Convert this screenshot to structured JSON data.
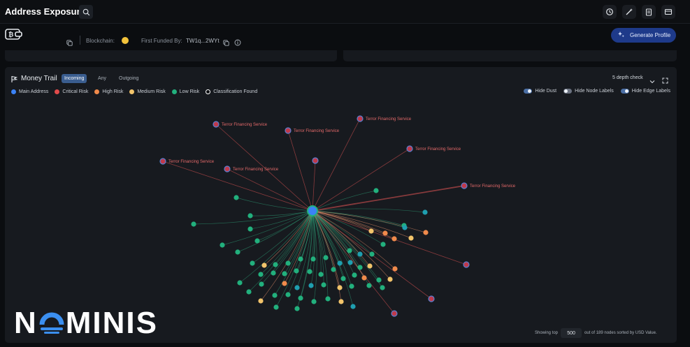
{
  "header": {
    "title": "Address Exposure",
    "icons": [
      "search-icon",
      "history-icon",
      "magic-wand-icon",
      "clipboard-icon",
      "card-icon"
    ]
  },
  "subheader": {
    "blockchain_label": "Blockchain:",
    "first_funded_label": "First Funded By:",
    "first_funded_value": "TW1q...2WYt",
    "generate_profile": "Generate Profile"
  },
  "money_trail": {
    "title": "Money Trail",
    "tabs": [
      {
        "label": "Incoming",
        "active": true
      },
      {
        "label": "Any",
        "active": false
      },
      {
        "label": "Outgoing",
        "active": false
      }
    ],
    "depth": "5 depth check",
    "legend": [
      {
        "label": "Main Address",
        "color": "#3b82f6"
      },
      {
        "label": "Critical Risk",
        "color": "#e14b4b"
      },
      {
        "label": "High Risk",
        "color": "#f08a4b"
      },
      {
        "label": "Medium Risk",
        "color": "#f2c46b"
      },
      {
        "label": "Low Risk",
        "color": "#22b07d"
      },
      {
        "label": "Classification Found",
        "color": "#ffffff"
      }
    ],
    "toggles": [
      {
        "label": "Hide Dust",
        "on": true
      },
      {
        "label": "Hide Node Labels",
        "on": false
      },
      {
        "label": "Hide Edge Labels",
        "on": true
      }
    ],
    "node_label": "Terror Financing Service",
    "footer": {
      "showing_top": "Showing top",
      "count": "500",
      "suffix": "out of 189 nodes sorted by USD Value."
    }
  },
  "logo": {
    "text": "NOMINIS"
  }
}
